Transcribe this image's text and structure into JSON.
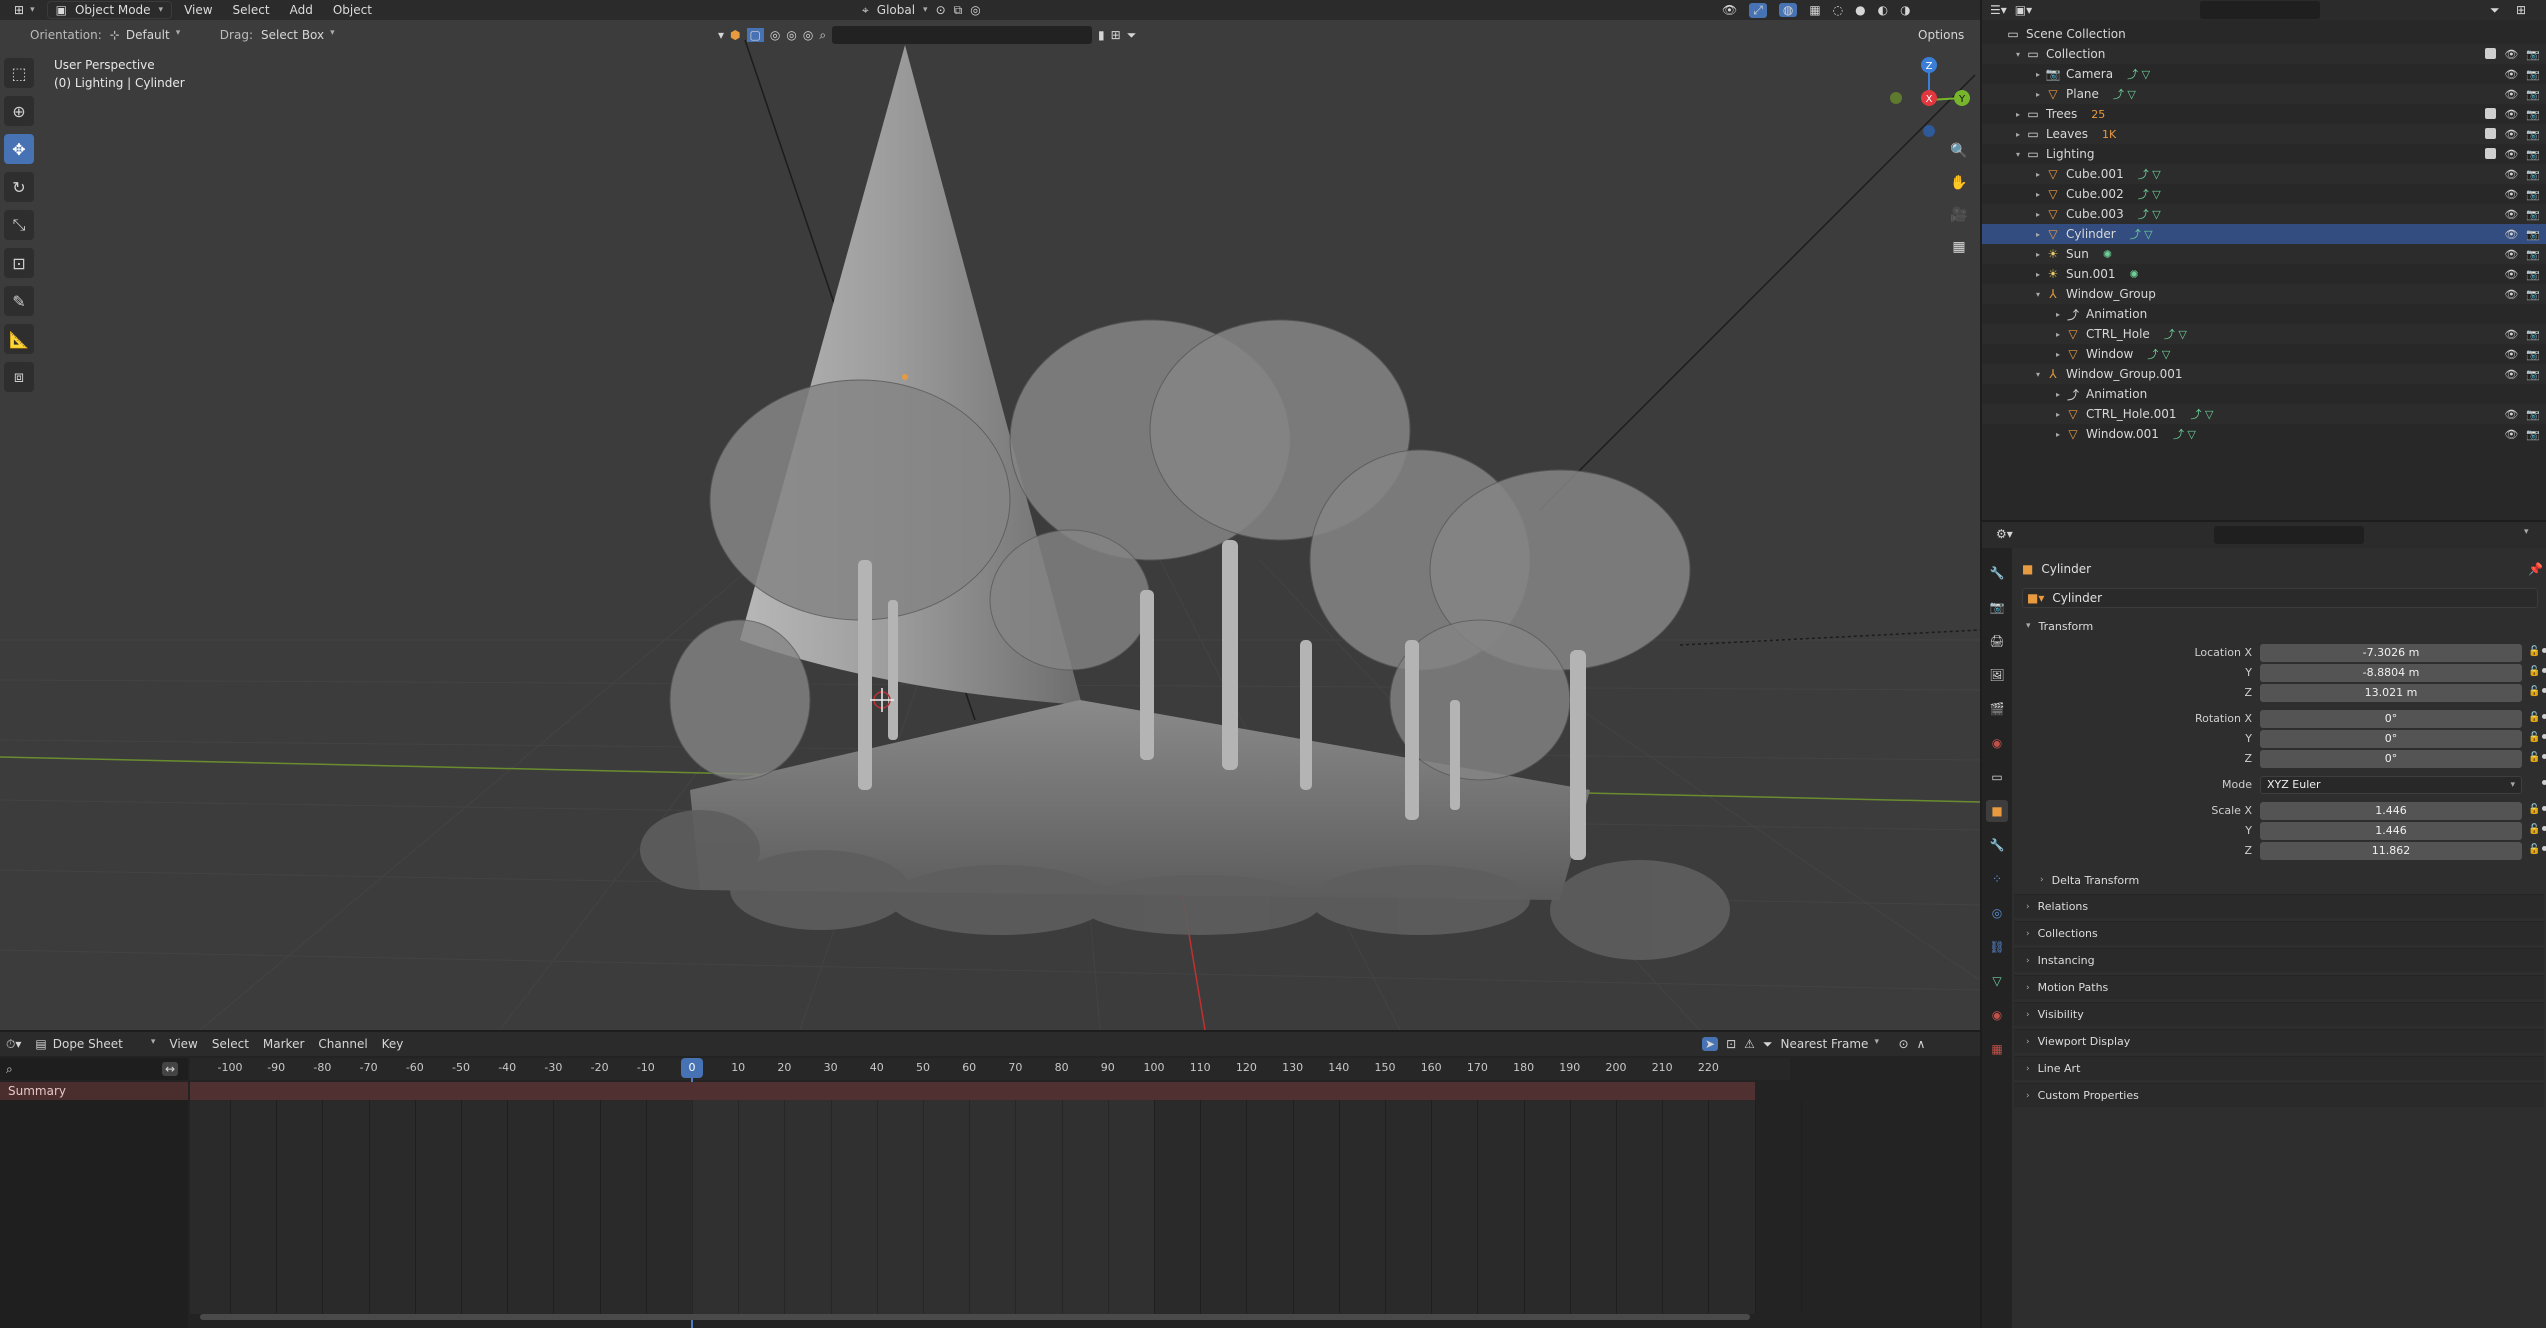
{
  "header": {
    "mode": "Object Mode",
    "menus": [
      "View",
      "Select",
      "Add",
      "Object"
    ],
    "transform_space": "Global",
    "options_label": "Options"
  },
  "viewport_toolbar": {
    "orientation_label": "Orientation:",
    "orientation_value": "Default",
    "drag_label": "Drag:",
    "drag_value": "Select Box"
  },
  "viewport": {
    "perspective": "User Perspective",
    "context": "(0) Lighting | Cylinder",
    "gizmo": {
      "x": "X",
      "y": "Y",
      "z": "Z",
      "x_color": "#e0383e",
      "y_color": "#76b52c",
      "z_color": "#3a7ed8"
    }
  },
  "tools": [
    "select-box-icon",
    "cursor-icon",
    "move-icon",
    "rotate-icon",
    "scale-icon",
    "transform-icon",
    "annotate-icon",
    "measure-icon",
    "add-cube-icon"
  ],
  "outliner": {
    "rows": [
      {
        "name": "Scene Collection",
        "depth": 0,
        "icon": "collection-icon",
        "kind": "scene"
      },
      {
        "name": "Collection",
        "depth": 1,
        "icon": "collection-icon",
        "kind": "collection",
        "check": true
      },
      {
        "name": "Camera",
        "depth": 2,
        "icon": "camera-icon",
        "kind": "object"
      },
      {
        "name": "Plane",
        "depth": 2,
        "icon": "mesh-icon",
        "kind": "object"
      },
      {
        "name": "Trees",
        "depth": 1,
        "icon": "collection-icon",
        "kind": "collection",
        "check": true,
        "badge": "25"
      },
      {
        "name": "Leaves",
        "depth": 1,
        "icon": "collection-icon",
        "kind": "collection",
        "check": true,
        "badge": "1K"
      },
      {
        "name": "Lighting",
        "depth": 1,
        "icon": "collection-icon",
        "kind": "collection",
        "check": true
      },
      {
        "name": "Cube.001",
        "depth": 2,
        "icon": "mesh-icon",
        "kind": "object"
      },
      {
        "name": "Cube.002",
        "depth": 2,
        "icon": "mesh-icon",
        "kind": "object"
      },
      {
        "name": "Cube.003",
        "depth": 2,
        "icon": "mesh-icon",
        "kind": "object"
      },
      {
        "name": "Cylinder",
        "depth": 2,
        "icon": "mesh-icon",
        "kind": "object"
      },
      {
        "name": "Sun",
        "depth": 2,
        "icon": "light-icon",
        "kind": "light"
      },
      {
        "name": "Sun.001",
        "depth": 2,
        "icon": "light-icon",
        "kind": "light"
      },
      {
        "name": "Window_Group",
        "depth": 2,
        "icon": "empty-icon",
        "kind": "empty"
      },
      {
        "name": "Animation",
        "depth": 3,
        "icon": "action-icon",
        "kind": "anim"
      },
      {
        "name": "CTRL_Hole",
        "depth": 3,
        "icon": "mesh-icon",
        "kind": "object"
      },
      {
        "name": "Window",
        "depth": 3,
        "icon": "mesh-icon",
        "kind": "object"
      },
      {
        "name": "Window_Group.001",
        "depth": 2,
        "icon": "empty-icon",
        "kind": "empty"
      },
      {
        "name": "Animation",
        "depth": 3,
        "icon": "action-icon",
        "kind": "anim"
      },
      {
        "name": "CTRL_Hole.001",
        "depth": 3,
        "icon": "mesh-icon",
        "kind": "object"
      },
      {
        "name": "Window.001",
        "depth": 3,
        "icon": "mesh-icon",
        "kind": "object"
      }
    ]
  },
  "properties": {
    "object_name": "Cylinder",
    "datablock_name": "Cylinder",
    "transform_label": "Transform",
    "location": {
      "label": "Location X",
      "x": "-7.3026 m",
      "y": "-8.8804 m",
      "z": "13.021 m"
    },
    "rotation": {
      "label": "Rotation X",
      "x": "0°",
      "y": "0°",
      "z": "0°"
    },
    "mode_label": "Mode",
    "mode_value": "XYZ Euler",
    "scale": {
      "label": "Scale X",
      "x": "1.446",
      "y": "1.446",
      "z": "11.862"
    },
    "axis_y": "Y",
    "axis_z": "Z",
    "delta_transform": "Delta Transform",
    "panels": [
      "Relations",
      "Collections",
      "Instancing",
      "Motion Paths",
      "Visibility",
      "Viewport Display",
      "Line Art",
      "Custom Properties"
    ]
  },
  "dopesheet": {
    "editor": "Dope Sheet",
    "menus": [
      "View",
      "Select",
      "Marker",
      "Channel",
      "Key"
    ],
    "snap": "Nearest Frame",
    "summary": "Summary",
    "current_frame": "0",
    "ticks": [
      "-100",
      "-90",
      "-80",
      "-70",
      "-60",
      "-50",
      "-40",
      "-30",
      "-20",
      "-10",
      "10",
      "20",
      "30",
      "40",
      "50",
      "60",
      "70",
      "80",
      "90",
      "100",
      "110",
      "120",
      "130",
      "140",
      "150",
      "160",
      "170",
      "180",
      "190",
      "200",
      "210",
      "220"
    ]
  }
}
